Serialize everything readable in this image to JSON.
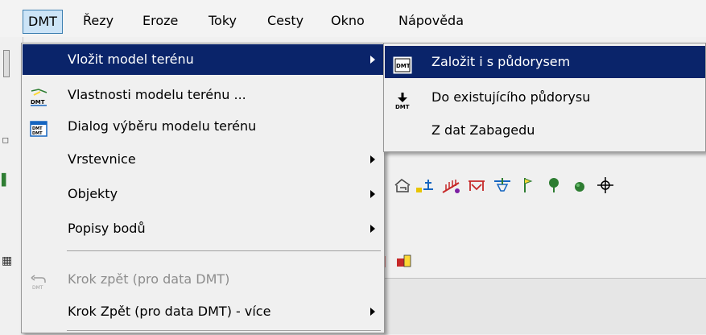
{
  "menubar": {
    "items": [
      "DMT",
      "Řezy",
      "Eroze",
      "Toky",
      "Cesty",
      "Okno",
      "Nápověda"
    ]
  },
  "dropdown": {
    "items": [
      {
        "label": "Vložit model terénu",
        "icon": "none",
        "submenu": true,
        "state": "highlighted"
      },
      {
        "label": "Vlastnosti modelu terénu ...",
        "icon": "dmt-properties-icon",
        "submenu": false,
        "state": "normal"
      },
      {
        "label": "Dialog výběru modelu terénu",
        "icon": "dmt-select-dialog-icon",
        "submenu": false,
        "state": "normal"
      },
      {
        "label": "Vrstevnice",
        "icon": "none",
        "submenu": true,
        "state": "normal"
      },
      {
        "label": "Objekty",
        "icon": "none",
        "submenu": true,
        "state": "normal"
      },
      {
        "label": "Popisy bodů",
        "icon": "none",
        "submenu": true,
        "state": "normal"
      },
      {
        "label": "Krok zpět (pro data DMT)",
        "icon": "undo-dmt-icon",
        "submenu": false,
        "state": "disabled"
      },
      {
        "label": "Krok Zpět (pro data DMT) - více",
        "icon": "none",
        "submenu": true,
        "state": "normal"
      }
    ]
  },
  "submenu": {
    "items": [
      {
        "label": "Založit i s půdorysem",
        "icon": "dmt-create-icon",
        "state": "highlighted"
      },
      {
        "label": "Do existujícího půdorysu",
        "icon": "dmt-insert-icon",
        "state": "normal"
      },
      {
        "label": "Z dat Zabagedu",
        "icon": "none",
        "state": "normal"
      }
    ]
  },
  "icon_text": {
    "dmt": "DMT",
    "dmt_select": "DMT DMT"
  },
  "colors": {
    "highlight": "#0a246a",
    "menubar_active": "#cce4f7",
    "disabled_text": "#8d8d8d"
  }
}
